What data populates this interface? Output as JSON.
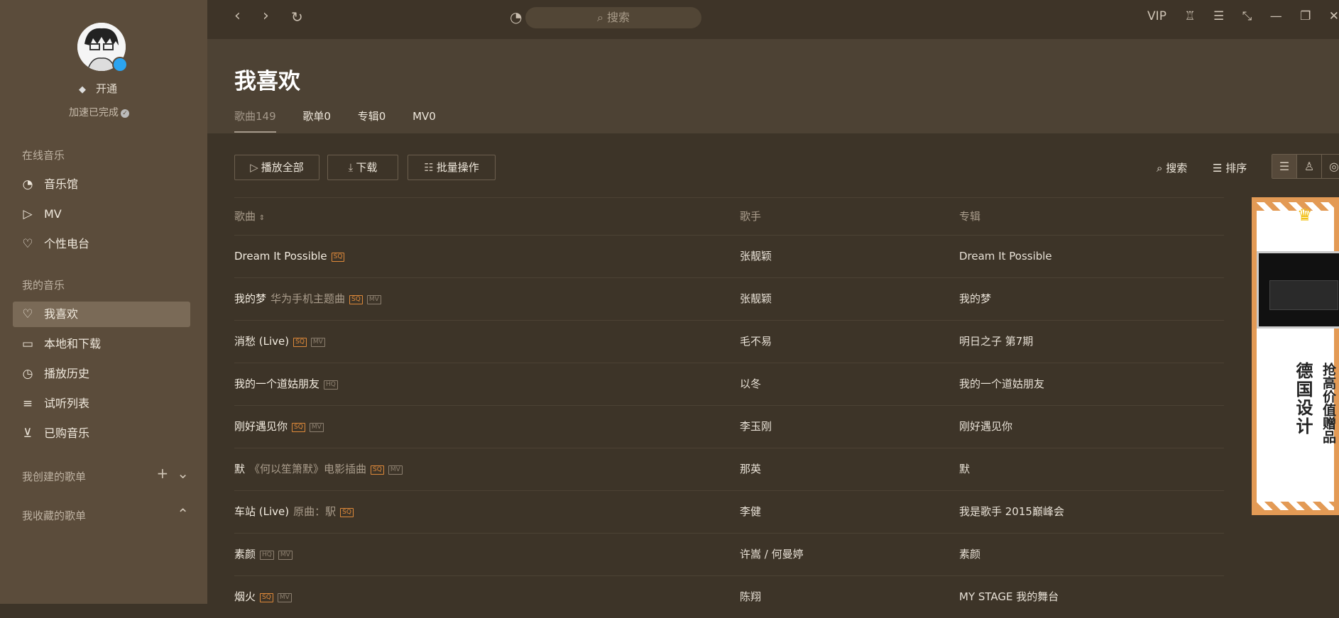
{
  "sidebar": {
    "vip_label": "开通",
    "accel_status": "加速已完成",
    "online_section": "在线音乐",
    "online_items": [
      {
        "icon": "music-hall-icon",
        "label": "音乐馆"
      },
      {
        "icon": "mv-icon",
        "label": "MV"
      },
      {
        "icon": "radio-heart-icon",
        "label": "个性电台"
      }
    ],
    "my_section": "我的音乐",
    "my_items": [
      {
        "icon": "heart-icon",
        "label": "我喜欢"
      },
      {
        "icon": "monitor-icon",
        "label": "本地和下载"
      },
      {
        "icon": "clock-icon",
        "label": "播放历史"
      },
      {
        "icon": "playlist-icon",
        "label": "试听列表"
      },
      {
        "icon": "cart-icon",
        "label": "已购音乐"
      }
    ],
    "created_playlists": "我创建的歌单",
    "collected_playlists": "我收藏的歌单"
  },
  "topbar": {
    "search_placeholder": "搜索",
    "vip": "VIP"
  },
  "header": {
    "title": "我喜欢",
    "tabs": [
      {
        "label": "歌曲149",
        "active": true
      },
      {
        "label": "歌单0"
      },
      {
        "label": "专辑0"
      },
      {
        "label": "MV0"
      }
    ]
  },
  "toolbar": {
    "play_all": "播放全部",
    "download": "下载",
    "batch": "批量操作",
    "search": "搜索",
    "sort": "排序"
  },
  "table": {
    "columns": [
      "歌曲",
      "歌手",
      "专辑"
    ],
    "rows": [
      {
        "title": "Dream It Possible",
        "sub": "",
        "tags": [
          "SQ"
        ],
        "artist": "张靓颖",
        "album": "Dream It Possible"
      },
      {
        "title": "我的梦",
        "sub": "华为手机主题曲",
        "tags": [
          "SQ",
          "MV"
        ],
        "artist": "张靓颖",
        "album": "我的梦"
      },
      {
        "title": "消愁 (Live)",
        "sub": "",
        "tags": [
          "SQ",
          "MV"
        ],
        "artist": "毛不易",
        "album": "明日之子 第7期"
      },
      {
        "title": "我的一个道姑朋友",
        "sub": "",
        "tags": [
          "HQ"
        ],
        "artist": "以冬",
        "album": "我的一个道姑朋友"
      },
      {
        "title": "刚好遇见你",
        "sub": "",
        "tags": [
          "SQ",
          "MV"
        ],
        "artist": "李玉刚",
        "album": "刚好遇见你"
      },
      {
        "title": "默",
        "sub": "《何以笙箫默》电影插曲",
        "tags": [
          "SQ",
          "MV"
        ],
        "artist": "那英",
        "album": "默"
      },
      {
        "title": "车站 (Live)",
        "sub": "原曲：駅",
        "tags": [
          "SQ"
        ],
        "artist": "李健",
        "album": "我是歌手 2015巅峰会"
      },
      {
        "title": "素颜",
        "sub": "",
        "tags": [
          "HQ",
          "MV"
        ],
        "artist": "许嵩 / 何曼婷",
        "album": "素颜"
      },
      {
        "title": "烟火",
        "sub": "",
        "tags": [
          "SQ",
          "MV"
        ],
        "artist": "陈翔",
        "album": "MY STAGE 我的舞台"
      }
    ]
  },
  "ad": {
    "line1": "德国设计",
    "line2": "抢高价值赠品"
  }
}
